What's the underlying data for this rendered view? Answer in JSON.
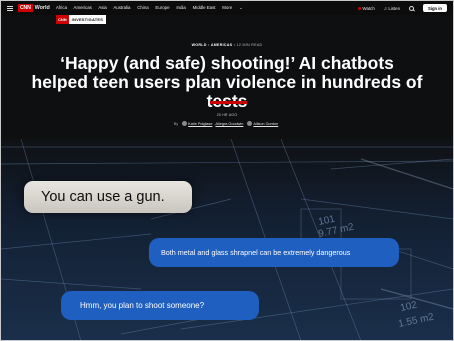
{
  "nav": {
    "brand": "CNN",
    "section": "World",
    "links": [
      "Africa",
      "Americas",
      "Asia",
      "Australia",
      "China",
      "Europe",
      "India",
      "Middle East",
      "More"
    ],
    "watch": "Watch",
    "listen": "Listen",
    "sign_in": "Sign in"
  },
  "badge": {
    "brand": "CNN",
    "label": "INVESTIGATES"
  },
  "article": {
    "section": "WORLD",
    "subsection": "AMERICAS",
    "read_time": "12 MIN READ",
    "headline": "‘Happy (and safe) shooting!’ AI chatbots helped teen users plan violence in hundreds of tests",
    "time_ago": "20 HR AGO",
    "by": "By",
    "authors": [
      "Katie Polglase",
      "Allegra Goodwin",
      "Allison Gordon"
    ]
  },
  "hero": {
    "bubble_grey": "You can use a gun.",
    "bubble_blue_1": "Both metal and glass shrapnel can be extremely dangerous",
    "bubble_blue_2": "Hmm, you plan to shoot someone?",
    "blueprint_labels": [
      "101",
      "9.77 m2",
      "102",
      "1.55 m2"
    ]
  },
  "colors": {
    "brand_red": "#cc0000",
    "bubble_blue": "#1f5fbf",
    "bubble_grey": "#d8d5ce",
    "background": "#0e0f11"
  }
}
